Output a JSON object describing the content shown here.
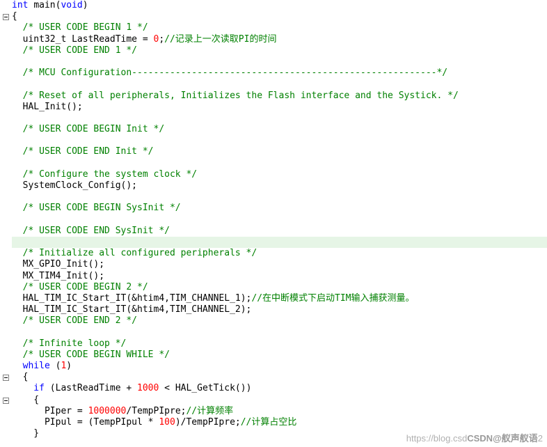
{
  "editor": {
    "app": "code-editor",
    "colors": {
      "keyword": "#0000ff",
      "comment": "#008000",
      "number": "#ff0000",
      "plain": "#000000",
      "highlight_line_bg": "#e6f5e6",
      "background": "#ffffff",
      "fold_marker": "#808080"
    },
    "fold_markers": [
      {
        "line": 1
      },
      {
        "line": 33
      },
      {
        "line": 35
      }
    ],
    "highlighted_line_index": 21,
    "lines": [
      [
        {
          "t": "int ",
          "c": "kw"
        },
        {
          "t": "main",
          "c": "pl"
        },
        {
          "t": "(",
          "c": "pl"
        },
        {
          "t": "void",
          "c": "kw"
        },
        {
          "t": ")",
          "c": "pl"
        }
      ],
      [
        {
          "t": "{",
          "c": "pl"
        }
      ],
      [
        {
          "t": "  /* USER CODE BEGIN 1 */",
          "c": "cm"
        }
      ],
      [
        {
          "t": "  uint32_t LastReadTime = ",
          "c": "pl"
        },
        {
          "t": "0",
          "c": "num"
        },
        {
          "t": ";",
          "c": "pl"
        },
        {
          "t": "//记录上一次读取PI的时间",
          "c": "cm"
        }
      ],
      [
        {
          "t": "  /* USER CODE END 1 */",
          "c": "cm"
        }
      ],
      [
        {
          "t": "",
          "c": "pl"
        }
      ],
      [
        {
          "t": "  /* MCU Configuration--------------------------------------------------------*/",
          "c": "cm"
        }
      ],
      [
        {
          "t": "",
          "c": "pl"
        }
      ],
      [
        {
          "t": "  /* Reset of all peripherals, Initializes the Flash interface and the Systick. */",
          "c": "cm"
        }
      ],
      [
        {
          "t": "  HAL_Init();",
          "c": "pl"
        }
      ],
      [
        {
          "t": "",
          "c": "pl"
        }
      ],
      [
        {
          "t": "  /* USER CODE BEGIN Init */",
          "c": "cm"
        }
      ],
      [
        {
          "t": "",
          "c": "pl"
        }
      ],
      [
        {
          "t": "  /* USER CODE END Init */",
          "c": "cm"
        }
      ],
      [
        {
          "t": "",
          "c": "pl"
        }
      ],
      [
        {
          "t": "  /* Configure the system clock */",
          "c": "cm"
        }
      ],
      [
        {
          "t": "  SystemClock_Config();",
          "c": "pl"
        }
      ],
      [
        {
          "t": "",
          "c": "pl"
        }
      ],
      [
        {
          "t": "  /* USER CODE BEGIN SysInit */",
          "c": "cm"
        }
      ],
      [
        {
          "t": "",
          "c": "pl"
        }
      ],
      [
        {
          "t": "  /* USER CODE END SysInit */",
          "c": "cm"
        }
      ],
      [
        {
          "t": "",
          "c": "pl"
        }
      ],
      [
        {
          "t": "  /* Initialize all configured peripherals */",
          "c": "cm"
        }
      ],
      [
        {
          "t": "  MX_GPIO_Init();",
          "c": "pl"
        }
      ],
      [
        {
          "t": "  MX_TIM4_Init();",
          "c": "pl"
        }
      ],
      [
        {
          "t": "  /* USER CODE BEGIN 2 */",
          "c": "cm"
        }
      ],
      [
        {
          "t": "  HAL_TIM_IC_Start_IT(&htim4,TIM_CHANNEL_1);",
          "c": "pl"
        },
        {
          "t": "//在中断模式下启动TIM输入捕获测量。",
          "c": "cm"
        }
      ],
      [
        {
          "t": "  HAL_TIM_IC_Start_IT(&htim4,TIM_CHANNEL_2);",
          "c": "pl"
        }
      ],
      [
        {
          "t": "  /* USER CODE END 2 */",
          "c": "cm"
        }
      ],
      [
        {
          "t": "",
          "c": "pl"
        }
      ],
      [
        {
          "t": "  /* Infinite loop */",
          "c": "cm"
        }
      ],
      [
        {
          "t": "  /* USER CODE BEGIN WHILE */",
          "c": "cm"
        }
      ],
      [
        {
          "t": "  while",
          "c": "kw"
        },
        {
          "t": " (",
          "c": "pl"
        },
        {
          "t": "1",
          "c": "num"
        },
        {
          "t": ")",
          "c": "pl"
        }
      ],
      [
        {
          "t": "  {",
          "c": "pl"
        }
      ],
      [
        {
          "t": "    if",
          "c": "kw"
        },
        {
          "t": " (LastReadTime + ",
          "c": "pl"
        },
        {
          "t": "1000",
          "c": "num"
        },
        {
          "t": " < HAL_GetTick())",
          "c": "pl"
        }
      ],
      [
        {
          "t": "    {",
          "c": "pl"
        }
      ],
      [
        {
          "t": "      PIper = ",
          "c": "pl"
        },
        {
          "t": "1000000",
          "c": "num"
        },
        {
          "t": "/TempPIpre;",
          "c": "pl"
        },
        {
          "t": "//计算频率",
          "c": "cm"
        }
      ],
      [
        {
          "t": "      PIpul = (TempPIpul * ",
          "c": "pl"
        },
        {
          "t": "100",
          "c": "num"
        },
        {
          "t": ")/TempPIpre;",
          "c": "pl"
        },
        {
          "t": "//计算占空比",
          "c": "cm"
        }
      ],
      [
        {
          "t": "    }",
          "c": "pl"
        }
      ]
    ]
  },
  "watermark": {
    "prefix": "https://blog.csd",
    "brand": "CSDN",
    "author": "@舣声舣语",
    "suffix": "2"
  }
}
